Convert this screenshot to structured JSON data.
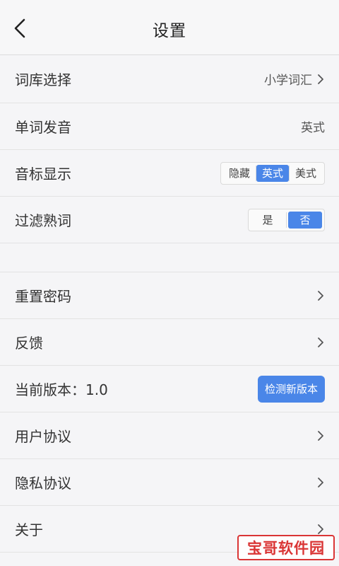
{
  "header": {
    "title": "设置",
    "back_icon": "chevron-left-icon"
  },
  "settings": {
    "word_bank": {
      "label": "词库选择",
      "value": "小学词汇"
    },
    "pronunciation": {
      "label": "单词发音",
      "value": "英式"
    },
    "phonetic": {
      "label": "音标显示",
      "options": [
        "隐藏",
        "英式",
        "美式"
      ],
      "selected": "英式"
    },
    "filter": {
      "label": "过滤熟词",
      "options": [
        "是",
        "否"
      ],
      "selected": "否"
    }
  },
  "more": {
    "reset_password": {
      "label": "重置密码"
    },
    "feedback": {
      "label": "反馈"
    },
    "version": {
      "label": "当前版本：1.0",
      "button": "检测新版本"
    },
    "user_agreement": {
      "label": "用户协议"
    },
    "privacy": {
      "label": "隐私协议"
    },
    "about": {
      "label": "关于"
    }
  },
  "watermark": {
    "text": "宝哥软件园"
  },
  "colors": {
    "accent": "#4a86e8",
    "watermark": "#d92b2b"
  }
}
